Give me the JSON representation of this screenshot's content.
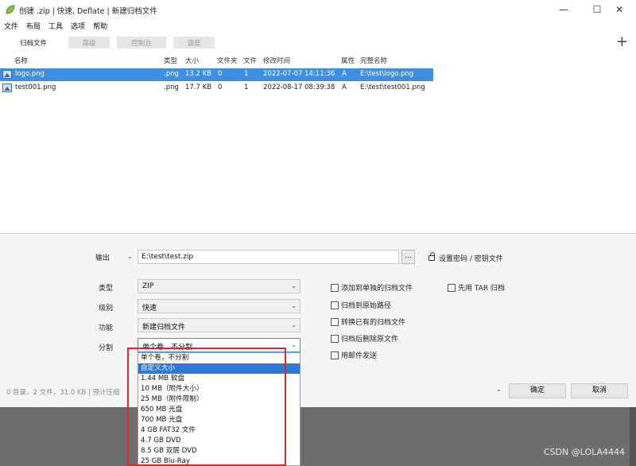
{
  "window": {
    "title": "创建 .zip | 快速, Deflate | 新建归档文件",
    "controls": [
      "—",
      "☐",
      "✕"
    ]
  },
  "menu": [
    "文件",
    "布局",
    "工具",
    "选项",
    "帮助"
  ],
  "tabs": [
    {
      "label": "归档文件",
      "disabled": false
    },
    {
      "label": "高级",
      "disabled": true
    },
    {
      "label": "控制台",
      "disabled": true
    },
    {
      "label": "调度",
      "disabled": true
    }
  ],
  "file_list": {
    "headers": [
      "名称",
      "类型",
      "大小",
      "文件夹",
      "文件",
      "修改时间",
      "属性",
      "完整名称"
    ],
    "rows": [
      {
        "name": "logo.png",
        "type": ".png",
        "size": "13.2 KB",
        "folders": "0",
        "files": "1",
        "modified": "2022-07-07 14:11:36",
        "attr": "A",
        "fullname": "E:\\test\\logo.png",
        "selected": true
      },
      {
        "name": "test001.png",
        "type": ".png",
        "size": "17.7 KB",
        "folders": "0",
        "files": "1",
        "modified": "2022-08-17 08:39:38",
        "attr": "A",
        "fullname": "E:\\test\\test001.png",
        "selected": false
      }
    ]
  },
  "output": {
    "label": "输出",
    "value": "E:\\test\\test.zip",
    "browse_label": "...",
    "password_label": "设置密码 / 密钥文件"
  },
  "options": {
    "type_label": "类型",
    "type_value": "ZIP",
    "level_label": "级别",
    "level_value": "快速",
    "function_label": "功能",
    "function_value": "新建归档文件",
    "split_label": "分割",
    "split_value": "单个卷，不分割"
  },
  "checkboxes": [
    "添加到单独的归档文件",
    "归档到原始路径",
    "转换已有的归档文件",
    "归档后删除原文件",
    "用邮件发送",
    "先用 TAR 归档"
  ],
  "status": "0 目录，2 文件，31.0 KB | 预计压缩",
  "buttons": {
    "ok": "确定",
    "cancel": "取消"
  },
  "split_dropdown": {
    "items": [
      "单个卷，不分割",
      "自定义大小",
      "1.44 MB 软盘",
      "10 MB（附件大小）",
      "25 MB（附件限制）",
      "650 MB 光盘",
      "700 MB 光盘",
      "4 GB FAT32 文件",
      "4.7 GB DVD",
      "8.5 GB 双层 DVD",
      "25 GB Blu-Ray"
    ],
    "highlighted_index": 1
  },
  "watermark": "CSDN @LOLA4444",
  "colors": {
    "selection": "#3d8fe0",
    "highlight_box": "#e3262a"
  }
}
